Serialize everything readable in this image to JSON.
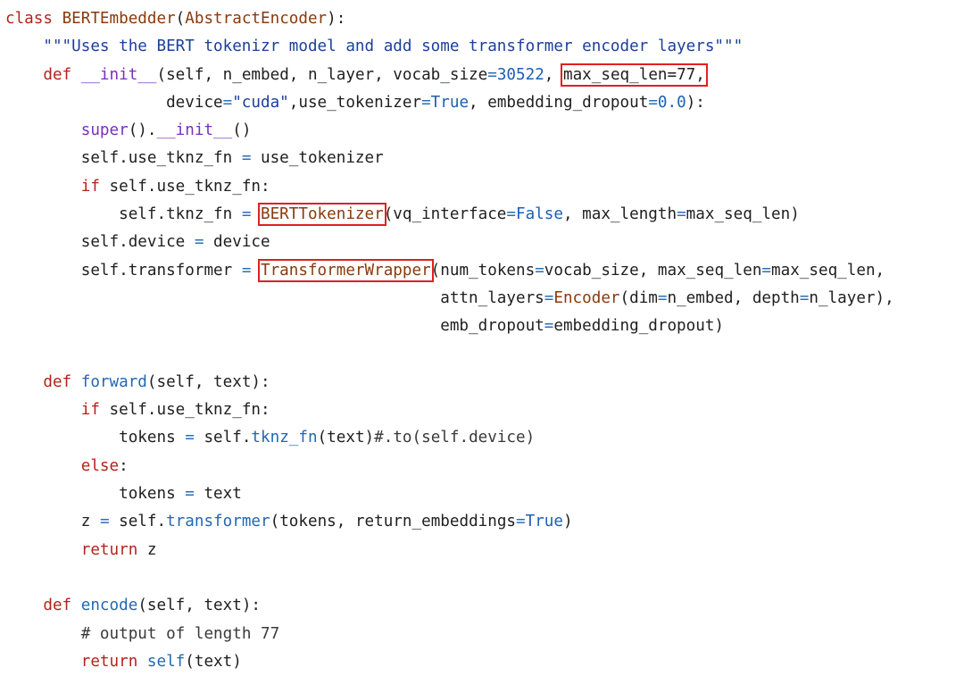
{
  "lines": [
    [
      {
        "t": "class ",
        "c": "kw"
      },
      {
        "t": "BERTEmbedder",
        "c": "fn"
      },
      {
        "t": "(",
        "c": "tx"
      },
      {
        "t": "AbstractEncoder",
        "c": "fn"
      },
      {
        "t": "):",
        "c": "tx"
      }
    ],
    [
      {
        "t": "    \"\"\"Uses the BERT tokenizr model and add some transformer encoder layers\"\"\"",
        "c": "st"
      }
    ],
    [
      {
        "t": "    ",
        "c": "tx"
      },
      {
        "t": "def ",
        "c": "kw"
      },
      {
        "t": "__init__",
        "c": "bt"
      },
      {
        "t": "(self, n_embed, n_layer, vocab_size",
        "c": "tx"
      },
      {
        "t": "=",
        "c": "op"
      },
      {
        "t": "30522",
        "c": "nm"
      },
      {
        "t": ", ",
        "c": "tx"
      },
      {
        "t": "max_seq_len=77,",
        "c": "tx",
        "h": true
      }
    ],
    [
      {
        "t": "                 device",
        "c": "tx"
      },
      {
        "t": "=",
        "c": "op"
      },
      {
        "t": "\"cuda\"",
        "c": "st"
      },
      {
        "t": ",use_tokenizer",
        "c": "tx"
      },
      {
        "t": "=",
        "c": "op"
      },
      {
        "t": "True",
        "c": "nm"
      },
      {
        "t": ", embedding_dropout",
        "c": "tx"
      },
      {
        "t": "=",
        "c": "op"
      },
      {
        "t": "0.0",
        "c": "nm"
      },
      {
        "t": "):",
        "c": "tx"
      }
    ],
    [
      {
        "t": "        ",
        "c": "tx"
      },
      {
        "t": "super",
        "c": "bt"
      },
      {
        "t": "().",
        "c": "tx"
      },
      {
        "t": "__init__",
        "c": "bt"
      },
      {
        "t": "()",
        "c": "tx"
      }
    ],
    [
      {
        "t": "        self.use_tknz_fn ",
        "c": "tx"
      },
      {
        "t": "=",
        "c": "op"
      },
      {
        "t": " use_tokenizer",
        "c": "tx"
      }
    ],
    [
      {
        "t": "        ",
        "c": "tx"
      },
      {
        "t": "if",
        "c": "kw"
      },
      {
        "t": " self.use_tknz_fn:",
        "c": "tx"
      }
    ],
    [
      {
        "t": "            self.tknz_fn ",
        "c": "tx"
      },
      {
        "t": "=",
        "c": "op"
      },
      {
        "t": " ",
        "c": "tx"
      },
      {
        "t": "BERTTokenizer",
        "c": "fn",
        "h": true
      },
      {
        "t": "(vq_interface",
        "c": "tx"
      },
      {
        "t": "=",
        "c": "op"
      },
      {
        "t": "False",
        "c": "nm"
      },
      {
        "t": ", max_length",
        "c": "tx"
      },
      {
        "t": "=",
        "c": "op"
      },
      {
        "t": "max_seq_len)",
        "c": "tx"
      }
    ],
    [
      {
        "t": "        self.device ",
        "c": "tx"
      },
      {
        "t": "=",
        "c": "op"
      },
      {
        "t": " device",
        "c": "tx"
      }
    ],
    [
      {
        "t": "        self.transformer ",
        "c": "tx"
      },
      {
        "t": "=",
        "c": "op"
      },
      {
        "t": " ",
        "c": "tx"
      },
      {
        "t": "TransformerWrapper",
        "c": "fn",
        "h": true
      },
      {
        "t": "(num_tokens",
        "c": "tx"
      },
      {
        "t": "=",
        "c": "op"
      },
      {
        "t": "vocab_size, max_seq_len",
        "c": "tx"
      },
      {
        "t": "=",
        "c": "op"
      },
      {
        "t": "max_seq_len,",
        "c": "tx"
      }
    ],
    [
      {
        "t": "                                              attn_layers",
        "c": "tx"
      },
      {
        "t": "=",
        "c": "op"
      },
      {
        "t": "Encoder",
        "c": "fn"
      },
      {
        "t": "(dim",
        "c": "tx"
      },
      {
        "t": "=",
        "c": "op"
      },
      {
        "t": "n_embed, depth",
        "c": "tx"
      },
      {
        "t": "=",
        "c": "op"
      },
      {
        "t": "n_layer),",
        "c": "tx"
      }
    ],
    [
      {
        "t": "                                              emb_dropout",
        "c": "tx"
      },
      {
        "t": "=",
        "c": "op"
      },
      {
        "t": "embedding_dropout)",
        "c": "tx"
      }
    ],
    [],
    [
      {
        "t": "    ",
        "c": "tx"
      },
      {
        "t": "def ",
        "c": "kw"
      },
      {
        "t": "forward",
        "c": "dm"
      },
      {
        "t": "(self, text):",
        "c": "tx"
      }
    ],
    [
      {
        "t": "        ",
        "c": "tx"
      },
      {
        "t": "if",
        "c": "kw"
      },
      {
        "t": " self.use_tknz_fn:",
        "c": "tx"
      }
    ],
    [
      {
        "t": "            tokens ",
        "c": "tx"
      },
      {
        "t": "=",
        "c": "op"
      },
      {
        "t": " self.",
        "c": "tx"
      },
      {
        "t": "tknz_fn",
        "c": "dm"
      },
      {
        "t": "(text)",
        "c": "tx"
      },
      {
        "t": "#.to(self.device)",
        "c": "cm"
      }
    ],
    [
      {
        "t": "        ",
        "c": "tx"
      },
      {
        "t": "else",
        "c": "kw"
      },
      {
        "t": ":",
        "c": "tx"
      }
    ],
    [
      {
        "t": "            tokens ",
        "c": "tx"
      },
      {
        "t": "=",
        "c": "op"
      },
      {
        "t": " text",
        "c": "tx"
      }
    ],
    [
      {
        "t": "        z ",
        "c": "tx"
      },
      {
        "t": "=",
        "c": "op"
      },
      {
        "t": " self.",
        "c": "tx"
      },
      {
        "t": "transformer",
        "c": "dm"
      },
      {
        "t": "(tokens, return_embeddings",
        "c": "tx"
      },
      {
        "t": "=",
        "c": "op"
      },
      {
        "t": "True",
        "c": "nm"
      },
      {
        "t": ")",
        "c": "tx"
      }
    ],
    [
      {
        "t": "        ",
        "c": "tx"
      },
      {
        "t": "return",
        "c": "kw"
      },
      {
        "t": " z",
        "c": "tx"
      }
    ],
    [],
    [
      {
        "t": "    ",
        "c": "tx"
      },
      {
        "t": "def ",
        "c": "kw"
      },
      {
        "t": "encode",
        "c": "dm"
      },
      {
        "t": "(self, text):",
        "c": "tx"
      }
    ],
    [
      {
        "t": "        ",
        "c": "tx"
      },
      {
        "t": "# output of length 77",
        "c": "cm"
      }
    ],
    [
      {
        "t": "        ",
        "c": "tx"
      },
      {
        "t": "return",
        "c": "kw"
      },
      {
        "t": " ",
        "c": "tx"
      },
      {
        "t": "self",
        "c": "dm"
      },
      {
        "t": "(text)",
        "c": "tx"
      }
    ]
  ]
}
